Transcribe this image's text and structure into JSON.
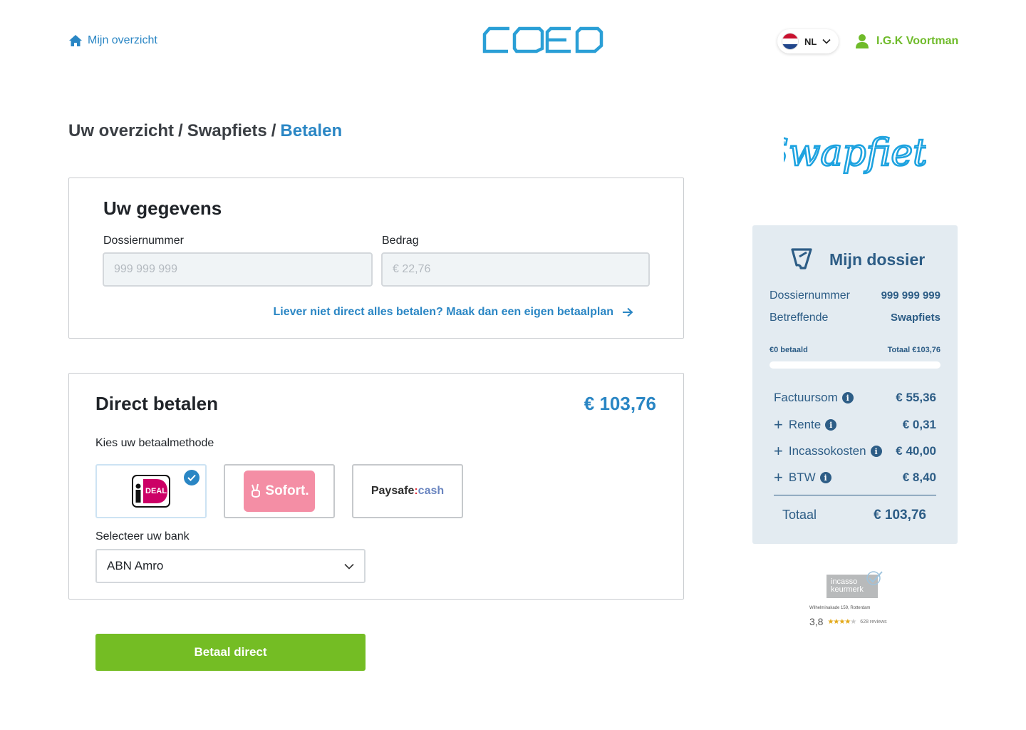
{
  "header": {
    "home_label": "Mijn overzicht",
    "brand": "COEO",
    "language": "NL",
    "user_name": "I.G.K Voortman"
  },
  "breadcrumb": {
    "item1": "Uw overzicht",
    "sep": "/",
    "item2": "Swapfiets",
    "current": "Betalen"
  },
  "gegevens": {
    "title": "Uw gegevens",
    "dossier_label": "Dossiernummer",
    "dossier_placeholder": "999 999 999",
    "amount_label": "Bedrag",
    "amount_placeholder": "€ 22,76",
    "plan_link": "Liever niet direct alles betalen? Maak dan een eigen betaalplan"
  },
  "betalen": {
    "title": "Direct betalen",
    "amount": "€ 103,76",
    "method_label": "Kies uw betaalmethode",
    "methods": [
      {
        "name": "iDEAL",
        "text": "DEAL",
        "selected": true
      },
      {
        "name": "Sofort",
        "text": "Sofort."
      },
      {
        "name": "Paysafecash",
        "text_main": "Paysafe",
        "text_sep": ":",
        "text_accent": "cash"
      }
    ],
    "bank_label": "Selecteer uw bank",
    "bank_value": "ABN Amro",
    "pay_button": "Betaal direct"
  },
  "sidebar": {
    "creditor": "Swapfiets",
    "dossier_title": "Mijn dossier",
    "dossier_number_label": "Dossiernummer",
    "dossier_number_value": "999 999 999",
    "regarding_label": "Betreffende",
    "regarding_value": "Swapfiets",
    "paid_label": "€0 betaald",
    "total_label_small": "Totaal €103,76",
    "progress_fraction": 0,
    "costs": [
      {
        "plus": "",
        "label": "Factuursom",
        "amount": "€ 55,36"
      },
      {
        "plus": "+",
        "label": "Rente",
        "amount": "€ 0,31"
      },
      {
        "plus": "+",
        "label": "Incassokosten",
        "amount": "€ 40,00"
      },
      {
        "plus": "+",
        "label": "BTW",
        "amount": "€ 8,40"
      }
    ],
    "total_label": "Totaal",
    "total_amount": "€ 103,76",
    "keurmerk": {
      "badge_line1": "incasso",
      "badge_line2": "keurmerk",
      "address": "Wilhelminakade 159, Rotterdam",
      "rating": "3,8",
      "reviews": "628 reviews"
    }
  },
  "colors": {
    "accent_blue": "#2a86c4",
    "pay_green": "#74bd24",
    "dossier_bg": "#e3ebf1",
    "dossier_text": "#2d5d86"
  }
}
